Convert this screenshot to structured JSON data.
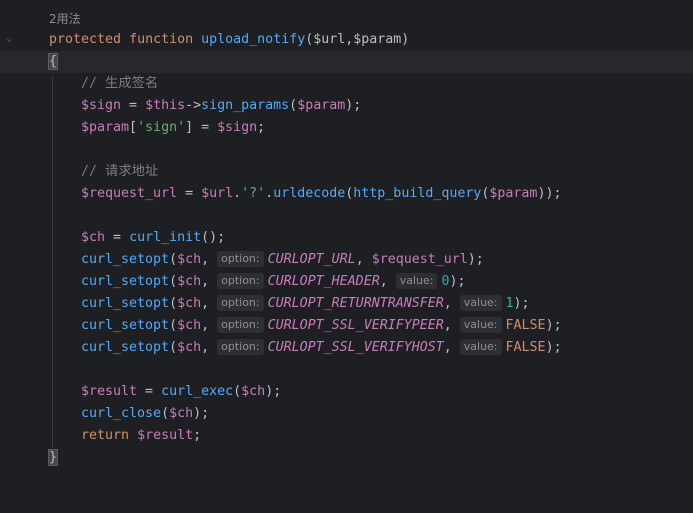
{
  "usage_hint": "2用法",
  "function": {
    "keyword_protected": "protected",
    "keyword_function": "function",
    "name": "upload_notify",
    "params_text": "($url,$param)"
  },
  "lines": {
    "open_brace": "{",
    "comment1": "// 生成签名",
    "sign_var": "$sign",
    "sign_eq": " = ",
    "sign_this": "$this",
    "sign_arrow": "->",
    "sign_call": "sign_params",
    "sign_args": "($param);",
    "param_var": "$param",
    "param_key_open": "[",
    "param_key": "'sign'",
    "param_key_close": "] = ",
    "param_val": "$sign",
    "param_end": ";",
    "comment2": "// 请求地址",
    "req_var": "$request_url",
    "req_eq": " = ",
    "req_url": "$url",
    "req_dot": ".",
    "req_q": "'?'",
    "req_dot2": ".",
    "req_urldecode": "urldecode",
    "req_open": "(",
    "req_hbq": "http_build_query",
    "req_open2": "(",
    "req_param": "$param",
    "req_close": "));",
    "ch_var": "$ch",
    "ch_eq": " = ",
    "ch_init": "curl_init",
    "ch_end": "();",
    "setopt": "curl_setopt",
    "ch_arg": "$ch",
    "option_hint": "option:",
    "value_hint": "value:",
    "opt1": "CURLOPT_URL",
    "opt1_val": "$request_url",
    "opt2": "CURLOPT_HEADER",
    "opt2_val": "0",
    "opt3": "CURLOPT_RETURNTRANSFER",
    "opt3_val": "1",
    "opt4": "CURLOPT_SSL_VERIFYPEER",
    "opt4_val": "FALSE",
    "opt5": "CURLOPT_SSL_VERIFYHOST",
    "opt5_val": "FALSE",
    "result_var": "$result",
    "result_eq": " = ",
    "exec": "curl_exec",
    "exec_arg": "$ch",
    "close_fn": "curl_close",
    "close_arg": "$ch",
    "return_kw": "return",
    "return_var": "$result",
    "close_brace": "}"
  },
  "colors": {
    "background": "#1e1f22",
    "keyword": "#cf8e6d",
    "function": "#56a8f5",
    "variable": "#c77dbb",
    "string": "#6aab73",
    "number": "#2aacb8",
    "comment": "#7a7e85"
  }
}
